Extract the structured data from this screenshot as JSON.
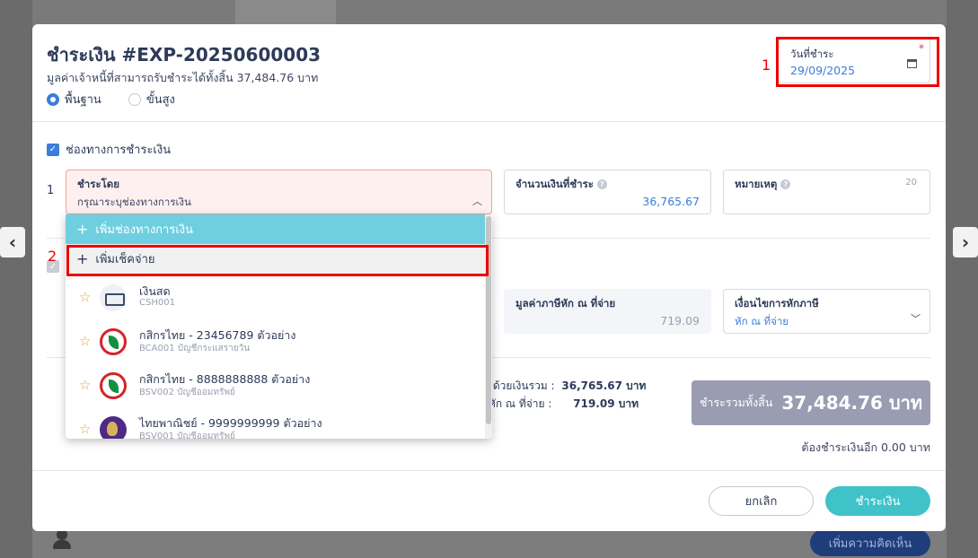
{
  "background": {
    "comment_button": "เพิ่มความคิดเห็น"
  },
  "modal": {
    "title": "ชำระเงิน #EXP-20250600003",
    "subtitle": "มูลค่าเจ้าหนี้ที่สามารถรับชำระได้ทั้งสิ้น 37,484.76 บาท",
    "modes": [
      {
        "label": "พื้นฐาน",
        "selected": true
      },
      {
        "label": "ขั้นสูง",
        "selected": false
      }
    ],
    "date_field": {
      "label": "วันที่ชำระ",
      "value": "29/09/2025",
      "required_mark": "*"
    },
    "annotation_1": "1",
    "annotation_2": "2",
    "channel_section": {
      "label": "ช่องทางการชำระเงิน",
      "checked": true
    },
    "row_number": "1",
    "pay_by": {
      "label": "ชำระโดย",
      "placeholder": "กรุณาระบุช่องทางการเงิน"
    },
    "amount": {
      "label": "จำนวนเงินที่ชำระ",
      "value": "36,765.67"
    },
    "note": {
      "label": "หมายเหตุ",
      "counter": "20"
    },
    "withholding": {
      "label": "มูลค่าภาษีหัก ณ ที่จ่าย",
      "value": "719.09"
    },
    "tax_condition": {
      "label": "เงื่อนไขการหักภาษี",
      "value": "หัก ณ ที่จ่าย"
    },
    "dropdown": {
      "add_channel": "เพิ่มช่องทางการเงิน",
      "add_cheque": "เพิ่มเช็คจ่าย",
      "items": [
        {
          "name": "เงินสด",
          "code": "CSH001",
          "logo": "cash-icon"
        },
        {
          "name": "กสิกรไทย - 23456789 ตัวอย่าง",
          "code": "BCA001 บัญชีกระแสรายวัน",
          "logo": "kbank-logo"
        },
        {
          "name": "กสิกรไทย - 8888888888 ตัวอย่าง",
          "code": "BSV002 บัญชีออมทรัพย์",
          "logo": "kbank-logo"
        },
        {
          "name": "ไทยพาณิชย์ - 9999999999 ตัวอย่าง",
          "code": "BSV001 บัญชีออมทรัพย์",
          "logo": "scb-logo"
        }
      ]
    },
    "summary": {
      "paid_label": "ระด้วยเงินรวม :",
      "paid_value": "36,765.67 บาท",
      "wht_label": "ษีหัก ณ ที่จ่าย :",
      "wht_value": "719.09 บาท"
    },
    "total": {
      "label": "ชำระรวมทั้งสิ้น",
      "amount": "37,484.76 บาท"
    },
    "remaining": "ต้องชำระเงินอีก 0.00 บาท",
    "cancel_button": "ยกเลิก",
    "pay_button": "ชำระเงิน"
  }
}
